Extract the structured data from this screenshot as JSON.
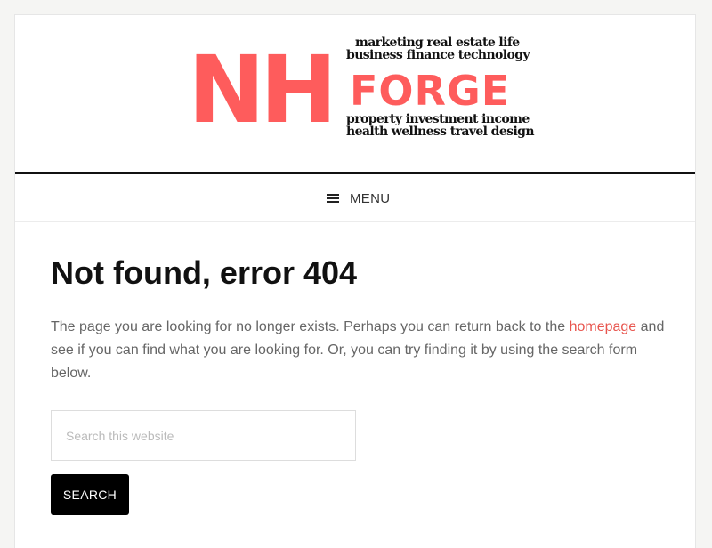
{
  "brand": {
    "logo_letters": "NH",
    "logo_word": "FORGE",
    "tagline_1": "marketing real estate life",
    "tagline_2": "business finance technology",
    "tagline_3": "property investment income",
    "tagline_4": "health wellness travel design",
    "accent_color": "#fe5c5c"
  },
  "nav": {
    "menu_label": "MENU",
    "menu_icon": "hamburger-menu-icon"
  },
  "main": {
    "title": "Not found, error 404",
    "text_before_link": "The page you are looking for no longer exists. Perhaps you can return back to the ",
    "link_text": "homepage",
    "text_after_link": " and see if you can find what you are looking for. Or, you can try finding it by using the search form below.",
    "link_color": "#e8554e"
  },
  "search": {
    "placeholder": "Search this website",
    "value": "",
    "button_label": "SEARCH"
  }
}
